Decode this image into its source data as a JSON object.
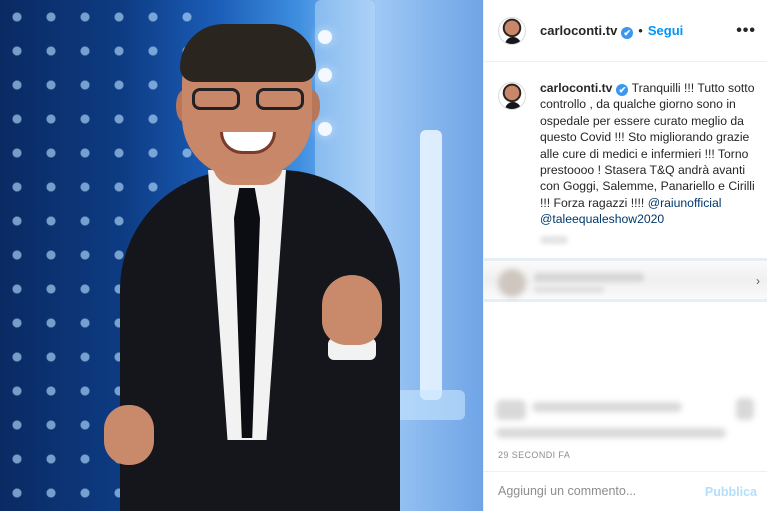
{
  "post": {
    "username": "carloconti.tv",
    "separator": "•",
    "follow_label": "Segui",
    "more_label": "•••",
    "verified_glyph": "✔",
    "caption": {
      "text_part1": "Tranquilli !!! Tutto sotto controllo , da qualche giorno sono in ospedale per essere curato meglio da questo Covid !!! Sto migliorando grazie alle cure di medici e infermieri !!! Torno prestoooo ! Stasera T&Q andrà avanti con Goggi, Salemme, Panariello e Cirilli !!! Forza ragazzi !!!! ",
      "mention1": "@raiunofficial",
      "mention2": "@taleequaleshow2020"
    },
    "timestamp": "29 SECONDI FA",
    "comment_placeholder": "Aggiungi un commento...",
    "publish_label": "Pubblica",
    "chevron": "›"
  },
  "colors": {
    "link": "#0095f6",
    "mention": "#00376b",
    "verified": "#3897f0"
  },
  "icons": [
    "verified-badge-icon",
    "more-options-icon",
    "chevron-right-icon"
  ]
}
